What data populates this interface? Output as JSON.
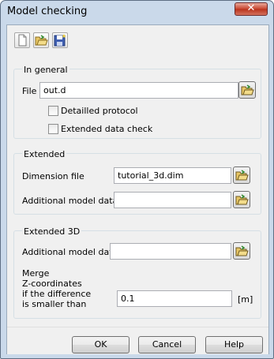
{
  "window": {
    "title": "Model checking",
    "close_label": "✕"
  },
  "toolbar": {
    "icons": [
      "new-document-icon",
      "open-folder-icon",
      "save-icon"
    ]
  },
  "general": {
    "title": "In general",
    "file_label": "File",
    "file_value": "out.d",
    "detailed_protocol_label": "Detailled protocol",
    "detailed_protocol_checked": false,
    "extended_check_label": "Extended data check",
    "extended_check_checked": false
  },
  "extended": {
    "title": "Extended",
    "dimension_label": "Dimension file",
    "dimension_value": "tutorial_3d.dim",
    "additional_label": "Additional model data",
    "additional_value": ""
  },
  "extended3d": {
    "title": "Extended 3D",
    "additional_label": "Additional model data",
    "additional_value": "",
    "merge_line1": "Merge",
    "merge_line2": "Z-coordinates",
    "merge_line3": "if the difference",
    "merge_line4": "is smaller than",
    "merge_value": "0.1",
    "unit": "[m]"
  },
  "buttons": {
    "ok": "OK",
    "cancel": "Cancel",
    "help": "Help"
  }
}
